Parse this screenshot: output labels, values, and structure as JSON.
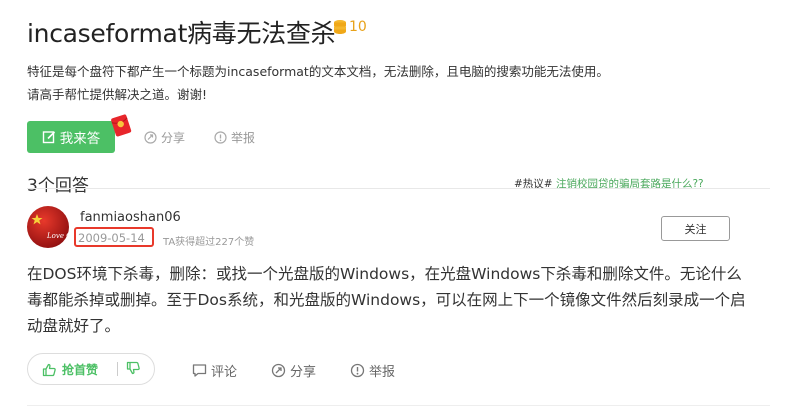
{
  "question": {
    "title": "incaseformat病毒无法查杀",
    "reward": "10",
    "description_lines": [
      "特征是每个盘符下都产生一个标题为incaseformat的文本文档，无法删除，且电脑的搜索功能无法使用。",
      "请高手帮忙提供解决之道。谢谢!"
    ],
    "answer_button": "我来答",
    "share": "分享",
    "report": "举报"
  },
  "answers": {
    "count_label": "3个回答",
    "hot_tag": "#热议#",
    "hot_link": "注销校园贷的骗局套路是什么??"
  },
  "answer": {
    "avatar_text": "Love China",
    "username": "fanmiaoshan06",
    "date": "2009-05-14",
    "likes_info": "TA获得超过227个赞",
    "follow": "关注",
    "body": "在DOS环境下杀毒，删除：或找一个光盘版的Windows，在光盘Windows下杀毒和删除文件。无论什么毒都能杀掉或删掉。至于Dos系统，和光盘版的Windows，可以在网上下一个镜像文件然后刻录成一个启动盘就好了。",
    "like_label": "抢首赞",
    "comment": "评论",
    "share": "分享",
    "report": "举报"
  },
  "colors": {
    "accent": "#4cc065",
    "highlight_box": "#e8392b",
    "coin": "#e8a21a"
  }
}
